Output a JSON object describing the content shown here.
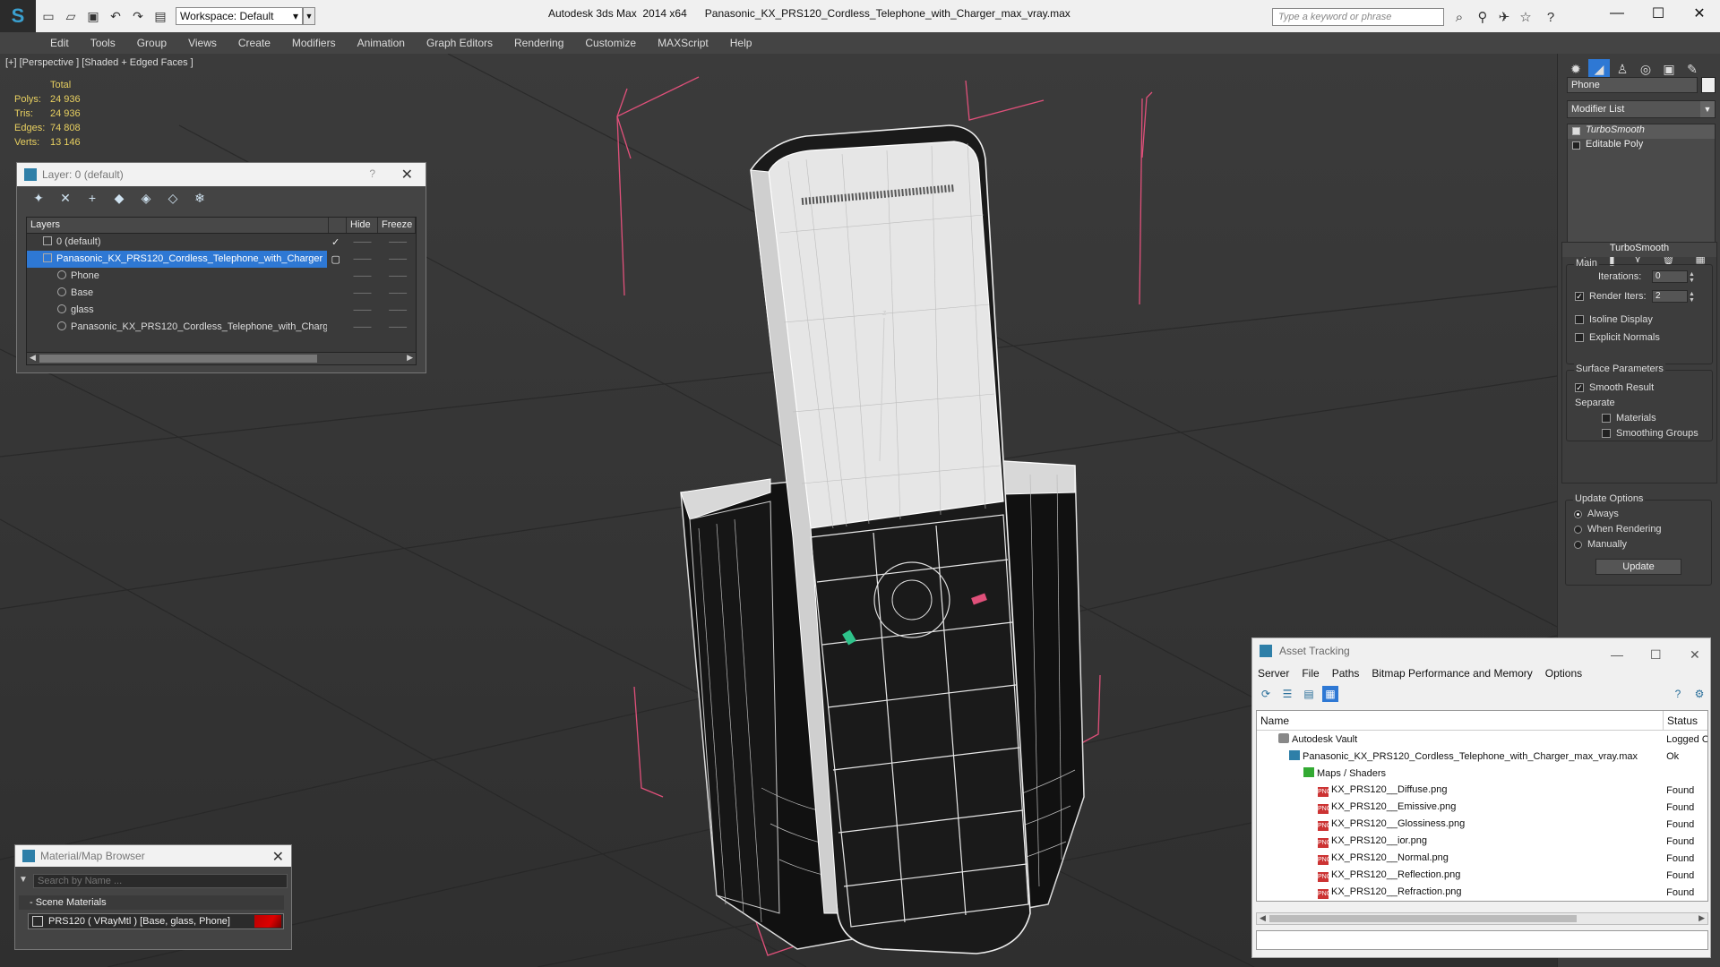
{
  "titlebar": {
    "workspace_label": "Workspace: Default",
    "app_title": "Autodesk 3ds Max  2014 x64",
    "file_title": "Panasonic_KX_PRS120_Cordless_Telephone_with_Charger_max_vray.max",
    "search_placeholder": "Type a keyword or phrase"
  },
  "menu": [
    "Edit",
    "Tools",
    "Group",
    "Views",
    "Create",
    "Modifiers",
    "Animation",
    "Graph Editors",
    "Rendering",
    "Customize",
    "MAXScript",
    "Help"
  ],
  "viewport": {
    "label": "[+] [Perspective ] [Shaded + Edged Faces ]",
    "stats": {
      "header": "Total",
      "rows": [
        {
          "k": "Polys:",
          "v": "24 936"
        },
        {
          "k": "Tris:",
          "v": "24 936"
        },
        {
          "k": "Edges:",
          "v": "74 808"
        },
        {
          "k": "Verts:",
          "v": "13 146"
        }
      ]
    },
    "gizmo_axis": "z"
  },
  "command_panel": {
    "object_name": "Phone",
    "modifier_list": "Modifier List",
    "stack": [
      "TurboSmooth",
      "Editable Poly"
    ],
    "rollout_title": "TurboSmooth",
    "main_label": "Main",
    "iterations_label": "Iterations:",
    "iterations_value": "0",
    "render_iters_label": "Render Iters:",
    "render_iters_value": "2",
    "isoline_label": "Isoline Display",
    "explicit_label": "Explicit Normals",
    "surface_label": "Surface Parameters",
    "smooth_result_label": "Smooth Result",
    "separate_label": "Separate",
    "materials_label": "Materials",
    "smoothing_groups_label": "Smoothing Groups",
    "update_options_label": "Update Options",
    "always_label": "Always",
    "when_rendering_label": "When Rendering",
    "manually_label": "Manually",
    "update_button": "Update"
  },
  "layer_dialog": {
    "title": "Layer: 0 (default)",
    "help": "?",
    "col_layers": "Layers",
    "col_hide": "Hide",
    "col_freeze": "Freeze",
    "rows": [
      {
        "name": "0 (default)",
        "indent": 0,
        "check": "✓",
        "selected": false
      },
      {
        "name": "Panasonic_KX_PRS120_Cordless_Telephone_with_Charger",
        "indent": 0,
        "check": "▢",
        "selected": true
      },
      {
        "name": "Phone",
        "indent": 1,
        "check": "",
        "selected": false
      },
      {
        "name": "Base",
        "indent": 1,
        "check": "",
        "selected": false
      },
      {
        "name": "glass",
        "indent": 1,
        "check": "",
        "selected": false
      },
      {
        "name": "Panasonic_KX_PRS120_Cordless_Telephone_with_Charger",
        "indent": 1,
        "check": "",
        "selected": false
      }
    ],
    "dash": "——"
  },
  "material_browser": {
    "title": "Material/Map Browser",
    "search_placeholder": "Search by Name ...",
    "group": "- Scene Materials",
    "item": "PRS120  ( VRayMtl ) [Base, glass, Phone]"
  },
  "asset_tracking": {
    "title": "Asset Tracking",
    "menu": [
      "Server",
      "File",
      "Paths",
      "Bitmap Performance and Memory",
      "Options"
    ],
    "col_name": "Name",
    "col_status": "Status",
    "rows": [
      {
        "name": "Autodesk Vault",
        "status": "Logged O",
        "indent": 1,
        "icon": "vault"
      },
      {
        "name": "Panasonic_KX_PRS120_Cordless_Telephone_with_Charger_max_vray.max",
        "status": "Ok",
        "indent": 2,
        "icon": "max"
      },
      {
        "name": "Maps / Shaders",
        "status": "",
        "indent": 3,
        "icon": "folder"
      },
      {
        "name": "KX_PRS120__Diffuse.png",
        "status": "Found",
        "indent": 4,
        "icon": "png"
      },
      {
        "name": "KX_PRS120__Emissive.png",
        "status": "Found",
        "indent": 4,
        "icon": "png"
      },
      {
        "name": "KX_PRS120__Glossiness.png",
        "status": "Found",
        "indent": 4,
        "icon": "png"
      },
      {
        "name": "KX_PRS120__ior.png",
        "status": "Found",
        "indent": 4,
        "icon": "png"
      },
      {
        "name": "KX_PRS120__Normal.png",
        "status": "Found",
        "indent": 4,
        "icon": "png"
      },
      {
        "name": "KX_PRS120__Reflection.png",
        "status": "Found",
        "indent": 4,
        "icon": "png"
      },
      {
        "name": "KX_PRS120__Refraction.png",
        "status": "Found",
        "indent": 4,
        "icon": "png"
      }
    ]
  },
  "colors": {
    "selection": "#2e78d4",
    "stats_text": "#e8d060",
    "bbox_lines": "#e0507a"
  }
}
